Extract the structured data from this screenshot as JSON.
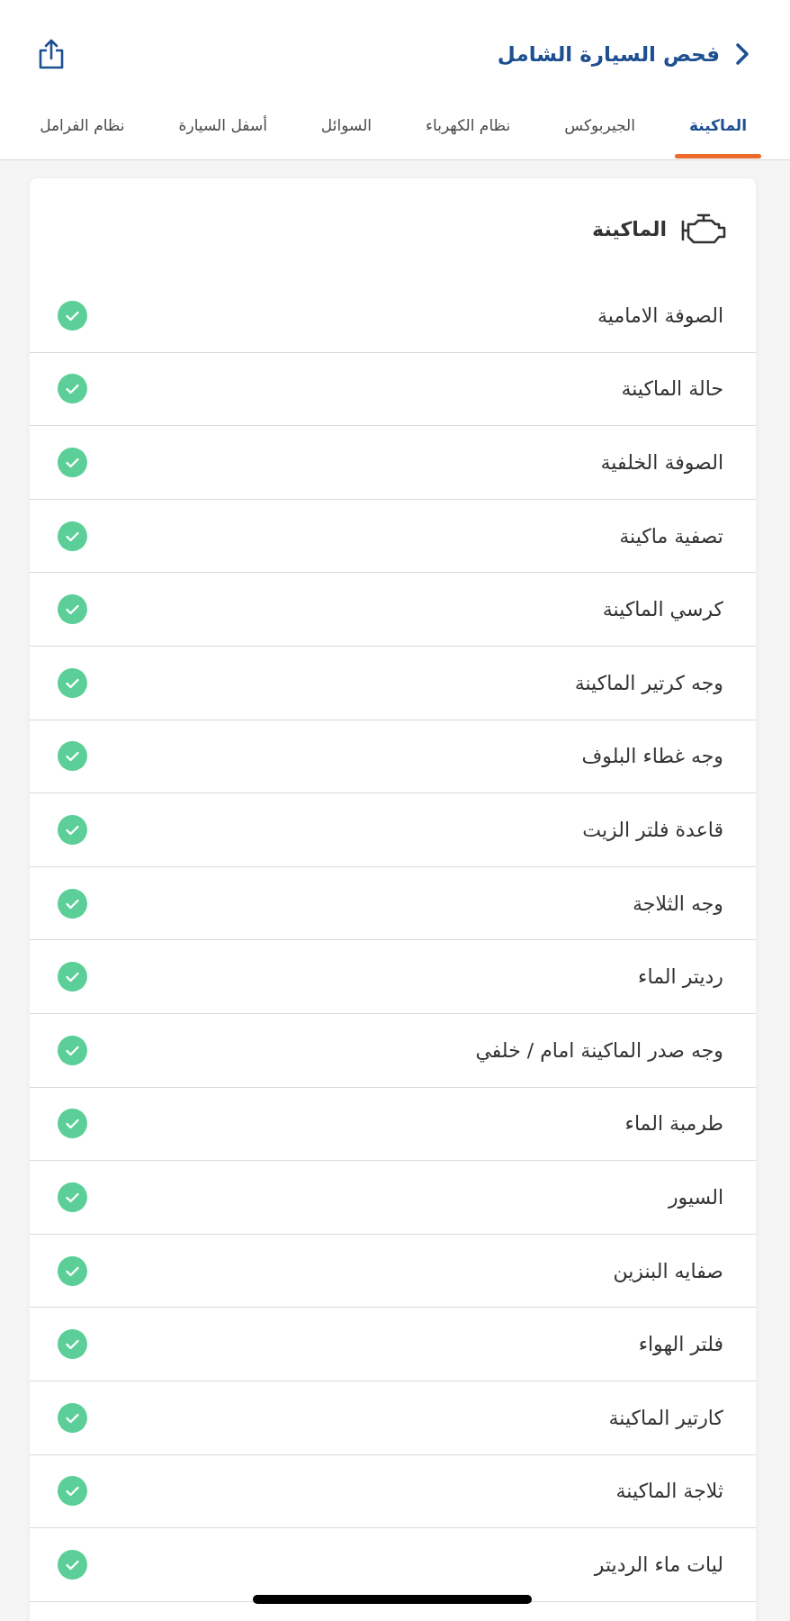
{
  "header": {
    "title": "فحص السيارة الشامل"
  },
  "tabs": [
    {
      "label": "الماكينة",
      "selected": true
    },
    {
      "label": "الجيربوكس",
      "selected": false
    },
    {
      "label": "نظام الكهرباء",
      "selected": false
    },
    {
      "label": "السوائل",
      "selected": false
    },
    {
      "label": "أسفل السيارة",
      "selected": false
    },
    {
      "label": "نظام الفرامل",
      "selected": false
    }
  ],
  "section": {
    "title": "الماكينة",
    "items": [
      {
        "label": "الصوفة الامامية",
        "passed": true
      },
      {
        "label": "حالة الماكينة",
        "passed": true
      },
      {
        "label": "الصوفة الخلفية",
        "passed": true
      },
      {
        "label": "تصفية ماكينة",
        "passed": true
      },
      {
        "label": "كرسي الماكينة",
        "passed": true
      },
      {
        "label": "وجه كرتير الماكينة",
        "passed": true
      },
      {
        "label": "وجه غطاء البلوف",
        "passed": true
      },
      {
        "label": "قاعدة فلتر الزيت",
        "passed": true
      },
      {
        "label": "وجه الثلاجة",
        "passed": true
      },
      {
        "label": "رديتر الماء",
        "passed": true
      },
      {
        "label": "وجه صدر الماكينة امام / خلفي",
        "passed": true
      },
      {
        "label": "طرمبة الماء",
        "passed": true
      },
      {
        "label": "السيور",
        "passed": true
      },
      {
        "label": "صفايه البنزين",
        "passed": true
      },
      {
        "label": "فلتر الهواء",
        "passed": true
      },
      {
        "label": "كارتير الماكينة",
        "passed": true
      },
      {
        "label": "ثلاجة الماكينة",
        "passed": true
      },
      {
        "label": "ليات ماء الرديتر",
        "passed": true
      }
    ]
  }
}
